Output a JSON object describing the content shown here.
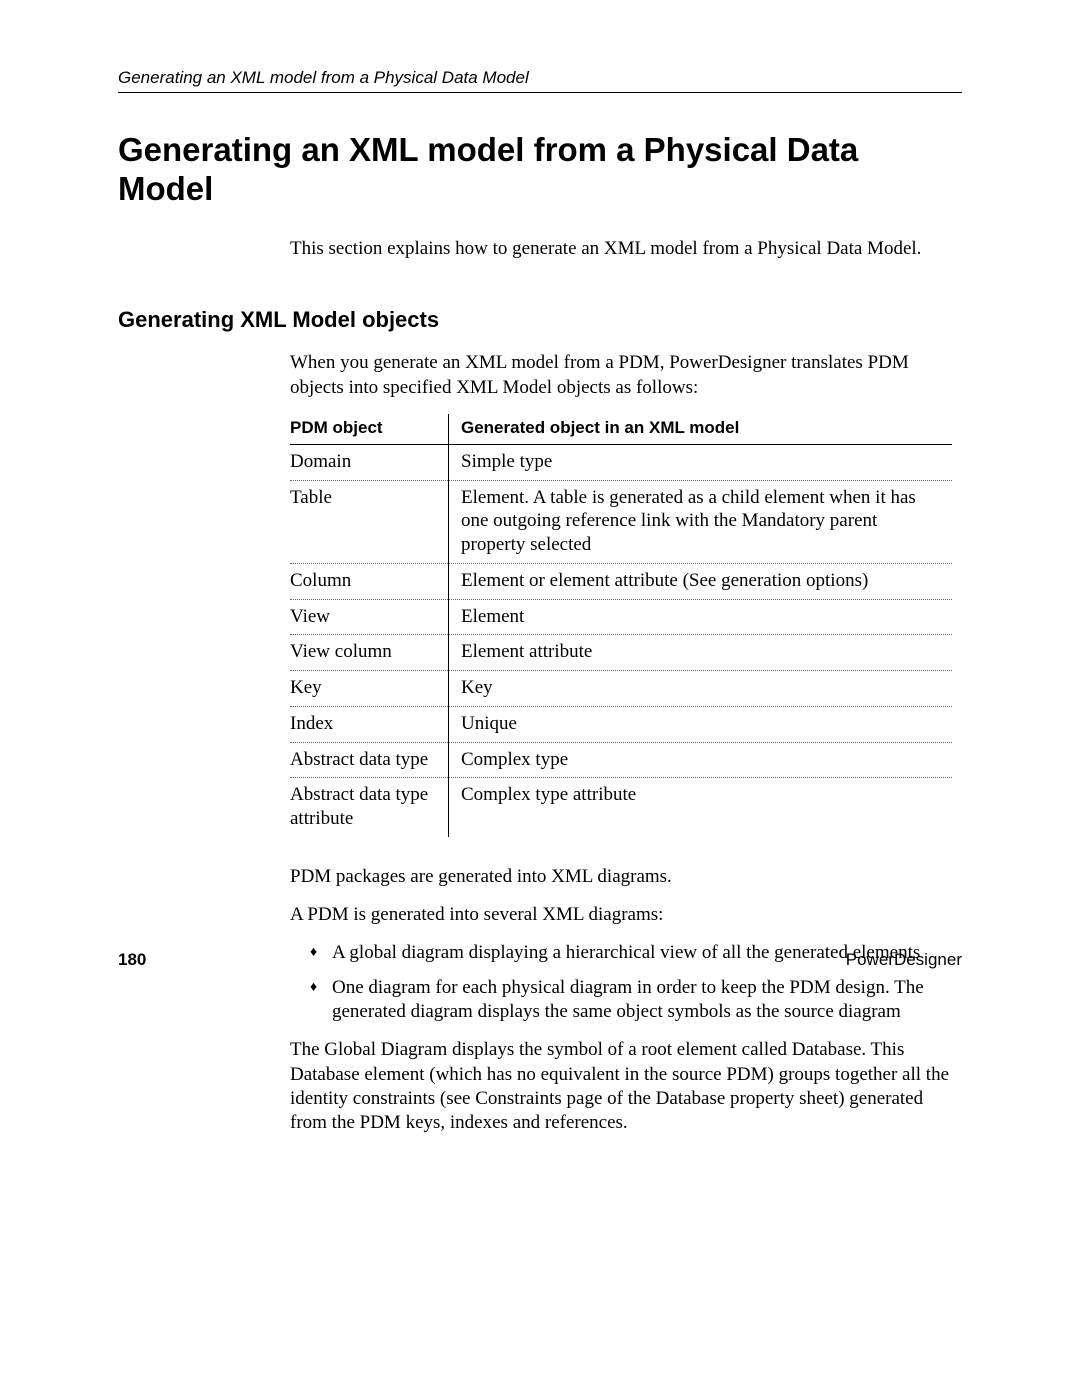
{
  "running_head": "Generating an XML model from a Physical Data Model",
  "title": "Generating an XML model from a Physical Data Model",
  "intro": "This section explains how to generate an XML model from a Physical Data Model.",
  "section2_title": "Generating XML Model objects",
  "section2_intro": "When you generate an XML model from a PDM, PowerDesigner translates PDM objects into specified XML Model objects as follows:",
  "table": {
    "header": {
      "c0": "PDM object",
      "c1": "Generated object in an XML model"
    },
    "rows": [
      {
        "c0": "Domain",
        "c1": "Simple type"
      },
      {
        "c0": "Table",
        "c1": "Element. A table is generated as a child element when it has one outgoing reference link with the Mandatory parent property selected"
      },
      {
        "c0": "Column",
        "c1": "Element or element attribute (See generation options)"
      },
      {
        "c0": "View",
        "c1": "Element"
      },
      {
        "c0": "View column",
        "c1": "Element attribute"
      },
      {
        "c0": "Key",
        "c1": "Key"
      },
      {
        "c0": "Index",
        "c1": "Unique"
      },
      {
        "c0": "Abstract data type",
        "c1": "Complex type"
      },
      {
        "c0": "Abstract data type attribute",
        "c1": "Complex type attribute"
      }
    ]
  },
  "after_table_p1": "PDM packages are generated into XML diagrams.",
  "after_table_p2": "A PDM is generated into several XML diagrams:",
  "bullets": [
    "A global diagram displaying a hierarchical view of all the generated elements",
    "One diagram for each physical diagram in order to keep the PDM design. The generated diagram displays the same object symbols as the source diagram"
  ],
  "after_bullets": "The Global Diagram displays the symbol of a root element called Database. This Database element (which has no equivalent in the source PDM) groups together all the identity constraints (see Constraints page of the Database property sheet) generated from the PDM keys, indexes and references.",
  "footer": {
    "page_number": "180",
    "product": "PowerDesigner"
  }
}
